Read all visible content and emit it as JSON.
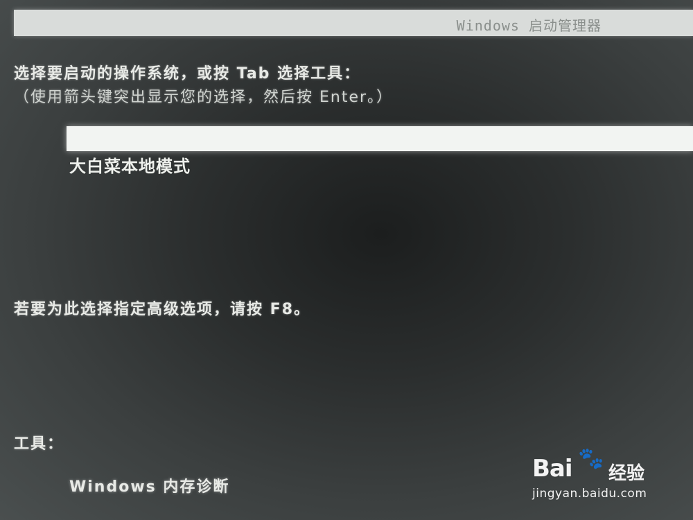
{
  "window": {
    "title": "Windows 启动管理器"
  },
  "prompt": {
    "main": "选择要启动的操作系统，或按 Tab 选择工具：",
    "hint": "（使用箭头键突出显示您的选择，然后按 Enter。）"
  },
  "os_list": [
    {
      "label": "",
      "selected": true
    },
    {
      "label": "大白菜本地模式",
      "selected": false
    }
  ],
  "advanced_hint": "若要为此选择指定高级选项，请按 F8。",
  "tools": {
    "title": "工具：",
    "items": [
      {
        "label": "Windows 内存诊断"
      }
    ]
  },
  "watermark": {
    "brand": "Bai",
    "paw": "🐾",
    "sub": "经验",
    "url": "jingyan.baidu.com"
  }
}
